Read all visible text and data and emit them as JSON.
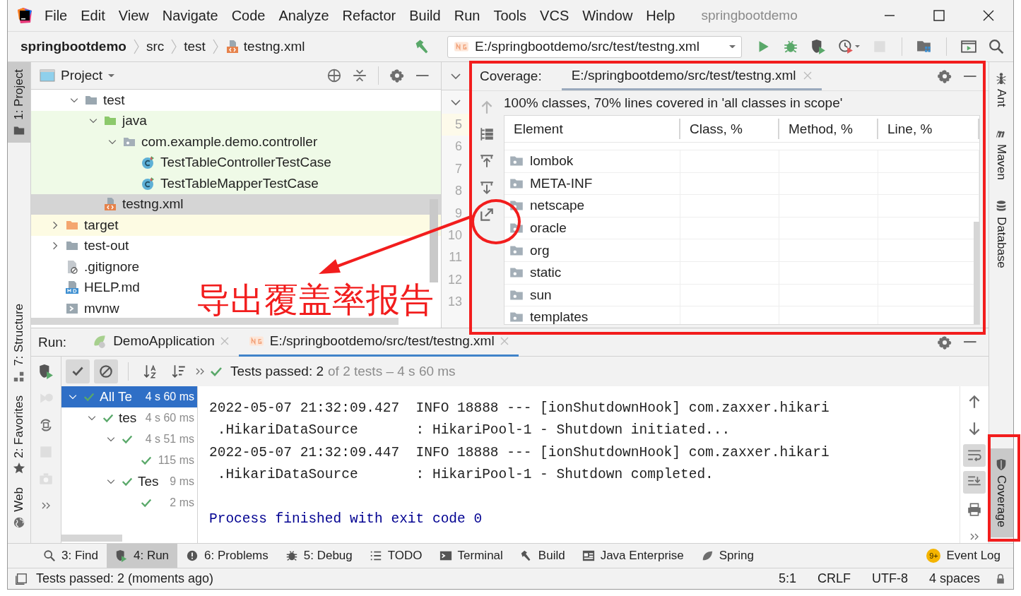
{
  "window": {
    "title": "springbootdemo"
  },
  "menu": [
    "File",
    "Edit",
    "View",
    "Navigate",
    "Code",
    "Analyze",
    "Refactor",
    "Build",
    "Run",
    "Tools",
    "VCS",
    "Window",
    "Help"
  ],
  "breadcrumbs": [
    {
      "label": "springbootdemo",
      "kind": "project"
    },
    {
      "label": "src",
      "kind": "folder"
    },
    {
      "label": "test",
      "kind": "folder"
    },
    {
      "label": "testng.xml",
      "kind": "xml"
    }
  ],
  "run_configuration": {
    "label": "E:/springbootdemo/src/test/testng.xml"
  },
  "main_toolbar": [
    {
      "kind": "run",
      "disabled": false
    },
    {
      "kind": "debug",
      "disabled": false
    },
    {
      "kind": "coverage",
      "disabled": false
    },
    {
      "kind": "profile",
      "disabled": false
    },
    {
      "kind": "stop",
      "disabled": true
    },
    {
      "kind": "structure",
      "disabled": false
    },
    {
      "kind": "run-anything",
      "disabled": false
    },
    {
      "kind": "search",
      "disabled": false
    }
  ],
  "left_tool_strip": [
    {
      "label": "1: Project",
      "kind": "project",
      "selected": true
    },
    {
      "label": "7: Structure",
      "kind": "structure",
      "selected": false
    },
    {
      "label": "2: Favorites",
      "kind": "favorites",
      "selected": false
    },
    {
      "label": "Web",
      "kind": "web",
      "selected": false
    }
  ],
  "project_panel": {
    "title": "Project",
    "tree": [
      {
        "kind": "offscreen",
        "children": [
          {
            "label": "test",
            "kind": "folder",
            "selected": false,
            "expanded": true,
            "test_source": false,
            "children": [
              {
                "label": "java",
                "kind": "source-folder",
                "selected": false,
                "expanded": true,
                "test_source": true,
                "children": [
                  {
                    "label": "com.example.demo.controller",
                    "kind": "package",
                    "selected": false,
                    "expanded": true,
                    "test_source": true,
                    "children": [
                      {
                        "label": "TestTableControllerTestCase",
                        "kind": "class",
                        "selected": false,
                        "test_source": true
                      },
                      {
                        "label": "TestTableMapperTestCase",
                        "kind": "class",
                        "selected": false,
                        "test_source": true
                      }
                    ]
                  }
                ]
              },
              {
                "label": "testng.xml",
                "kind": "xml",
                "selected": true,
                "test_source": false
              }
            ]
          }
        ]
      },
      {
        "label": "target",
        "kind": "excluded-folder",
        "selected": false,
        "expanded": false,
        "test_source": false
      },
      {
        "label": "test-out",
        "kind": "folder",
        "selected": false,
        "expanded": false,
        "test_source": false
      },
      {
        "label": ".gitignore",
        "kind": "ignore-file",
        "selected": false,
        "test_source": false
      },
      {
        "label": "HELP.md",
        "kind": "markdown-file",
        "selected": false,
        "test_source": false
      },
      {
        "label": "mvnw",
        "kind": "script-file",
        "selected": false,
        "test_source": false
      }
    ]
  },
  "line_numbers": [
    "5",
    "6",
    "7",
    "8",
    "9",
    "10",
    "11",
    "12",
    "13"
  ],
  "coverage_panel": {
    "label": "Coverage:",
    "tab": {
      "label": "E:/springbootdemo/src/test/testng.xml",
      "selected": true
    },
    "summary": "100% classes, 70% lines covered in 'all classes in scope'",
    "actions": [
      {
        "kind": "up",
        "disabled": true
      },
      {
        "kind": "flatten",
        "disabled": false
      },
      {
        "kind": "import",
        "disabled": false
      },
      {
        "kind": "export-down",
        "disabled": false
      },
      {
        "kind": "export",
        "disabled": false
      }
    ],
    "columns": [
      "Element",
      "Class, %",
      "Method, %",
      "Line, %"
    ],
    "rows": [
      "lombok",
      "META-INF",
      "netscape",
      "oracle",
      "org",
      "static",
      "sun",
      "templates"
    ]
  },
  "run_panel": {
    "label": "Run:",
    "tabs": [
      {
        "label": "DemoApplication",
        "kind": "spring",
        "selected": false
      },
      {
        "label": "E:/springbootdemo/src/test/testng.xml",
        "kind": "testng",
        "selected": true
      }
    ],
    "side_actions": [
      {
        "kind": "run-coverage",
        "disabled": false
      },
      {
        "kind": "rerun-failed",
        "disabled": true
      },
      {
        "kind": "auto-test",
        "disabled": false
      },
      {
        "kind": "stop",
        "disabled": true
      },
      {
        "kind": "snapshot",
        "disabled": true
      }
    ],
    "toolbar": [
      {
        "kind": "show-passed",
        "on": true
      },
      {
        "kind": "show-ignored",
        "on": true
      },
      {
        "kind": "sort-alpha",
        "on": false
      },
      {
        "kind": "sort-duration",
        "on": false
      }
    ],
    "status": {
      "passed": "Tests passed: 2",
      "detail": "of 2 tests – 4 s 60 ms"
    },
    "test_tree": [
      {
        "name": "All Te",
        "duration": "4 s 60 ms",
        "selected": true,
        "expanded": true,
        "children": [
          {
            "name": "tes",
            "duration": "4 s 60 ms",
            "selected": false,
            "expanded": true,
            "children": [
              {
                "duration": "4 s 51 ms",
                "selected": false,
                "expanded": true,
                "children": [
                  {
                    "duration": "115 ms",
                    "selected": false
                  }
                ]
              },
              {
                "name": "Tes",
                "duration": "9 ms",
                "selected": false,
                "expanded": true,
                "children": [
                  {
                    "duration": "2 ms",
                    "selected": false
                  }
                ]
              }
            ]
          }
        ]
      }
    ],
    "console": [
      {
        "text": "2022-05-07 21:32:09.427  INFO 18888 --- [ionShutdownHook] com.zaxxer.hikari",
        "kind": "log"
      },
      {
        "text": " .HikariDataSource       : HikariPool-1 - Shutdown initiated...",
        "kind": "log"
      },
      {
        "text": "2022-05-07 21:32:09.447  INFO 18888 --- [ionShutdownHook] com.zaxxer.hikari",
        "kind": "log"
      },
      {
        "text": " .HikariDataSource       : HikariPool-1 - Shutdown completed.",
        "kind": "log"
      },
      {
        "text": "Process finished with exit code 0",
        "kind": "system"
      }
    ],
    "console_actions": [
      {
        "kind": "up",
        "on": false
      },
      {
        "kind": "down",
        "on": false
      },
      {
        "kind": "soft-wrap",
        "on": true
      },
      {
        "kind": "scroll-end",
        "on": true
      },
      {
        "kind": "print",
        "on": false
      }
    ]
  },
  "right_tool_strip": [
    {
      "label": "Ant",
      "kind": "ant",
      "selected": false
    },
    {
      "label": "Maven",
      "kind": "maven",
      "selected": false
    },
    {
      "label": "Database",
      "kind": "database",
      "selected": false
    },
    {
      "label": "Coverage",
      "kind": "coverage",
      "selected": true
    }
  ],
  "tool_windows_bar": [
    {
      "label": "3: Find",
      "kind": "find",
      "selected": false
    },
    {
      "label": "4: Run",
      "kind": "run",
      "selected": true
    },
    {
      "label": "6: Problems",
      "kind": "problems",
      "selected": false
    },
    {
      "label": "5: Debug",
      "kind": "debug",
      "selected": false
    },
    {
      "label": "TODO",
      "kind": "todo",
      "selected": false
    },
    {
      "label": "Terminal",
      "kind": "terminal",
      "selected": false
    },
    {
      "label": "Build",
      "kind": "build",
      "selected": false
    },
    {
      "label": "Java Enterprise",
      "kind": "enterprise",
      "selected": false
    },
    {
      "label": "Spring",
      "kind": "spring",
      "selected": false
    }
  ],
  "event_log": {
    "label": "Event Log",
    "badge": "9+"
  },
  "status_bar": {
    "message": "Tests passed: 2 (moments ago)",
    "items": [
      "5:1",
      "CRLF",
      "UTF-8",
      "4 spaces"
    ]
  },
  "annotation": {
    "label": "导出覆盖率报告"
  }
}
